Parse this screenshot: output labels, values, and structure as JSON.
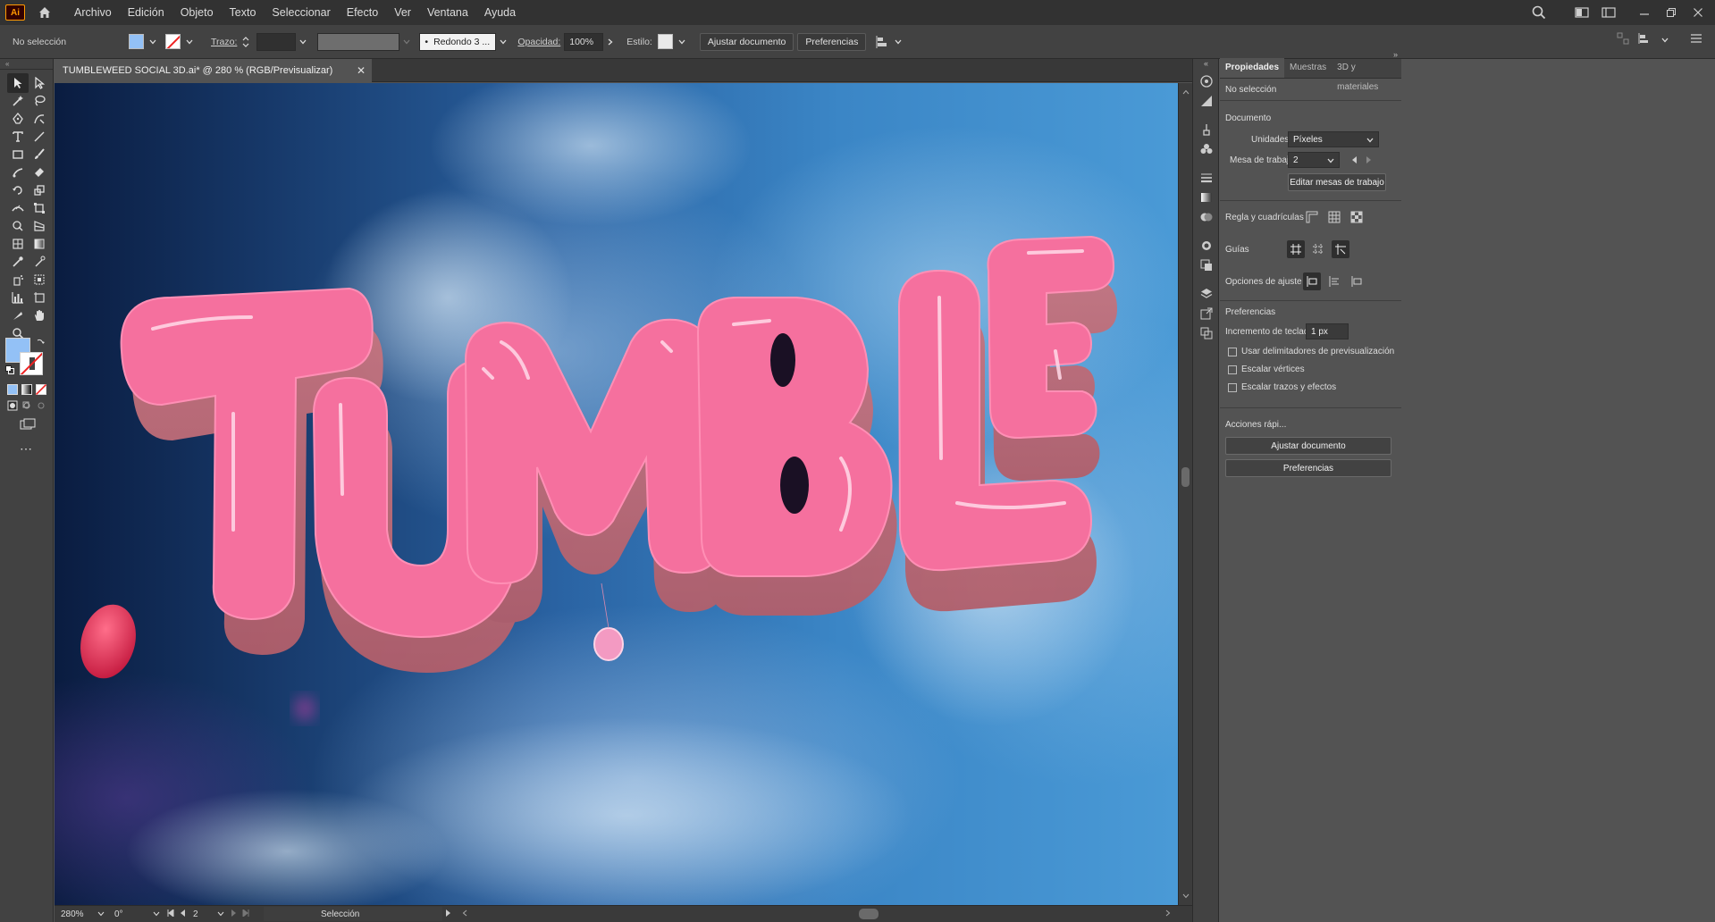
{
  "app": {
    "logo_text": "Ai"
  },
  "menu": [
    "Archivo",
    "Edición",
    "Objeto",
    "Texto",
    "Seleccionar",
    "Efecto",
    "Ver",
    "Ventana",
    "Ayuda"
  ],
  "controlbar": {
    "selection_status": "No selección",
    "stroke_label": "Trazo:",
    "brush_value": "Redondo 3 ...",
    "opacity_label": "Opacidad:",
    "opacity_value": "100%",
    "style_label": "Estilo:",
    "fit_document_button": "Ajustar documento",
    "preferences_button": "Preferencias"
  },
  "document": {
    "tab_title": "TUMBLEWEED SOCIAL 3D.ai* @ 280 % (RGB/Previsualizar)",
    "artwork_text": "TUMBLE"
  },
  "statusbar": {
    "zoom": "280%",
    "rotation": "0°",
    "artboard": "2",
    "tool_name": "Selección"
  },
  "properties": {
    "tabs": [
      "Propiedades",
      "Muestras",
      "3D y materiales"
    ],
    "selection_status": "No selección",
    "document_heading": "Documento",
    "units_label": "Unidades:",
    "units_value": "Píxeles",
    "artboard_label": "Mesa de trabajo:",
    "artboard_value": "2",
    "edit_artboards_button": "Editar mesas de trabajo",
    "rulers_label": "Regla y cuadrículas",
    "guides_label": "Guías",
    "snap_label": "Opciones de ajuste",
    "preferences_heading": "Preferencias",
    "keyboard_increment_label": "Incremento de teclado:",
    "keyboard_increment_value": "1 px",
    "checkboxes": [
      "Usar delimitadores de previsualización",
      "Escalar vértices",
      "Escalar trazos y efectos"
    ],
    "quick_actions_heading": "Acciones rápi...",
    "quick_fit_button": "Ajustar documento",
    "quick_preferences_button": "Preferencias"
  },
  "colors": {
    "fill_swatch": "#93c1f6",
    "letter_pink": "#f5709e",
    "ui_dark": "#323232",
    "ui_panel": "#424242"
  }
}
